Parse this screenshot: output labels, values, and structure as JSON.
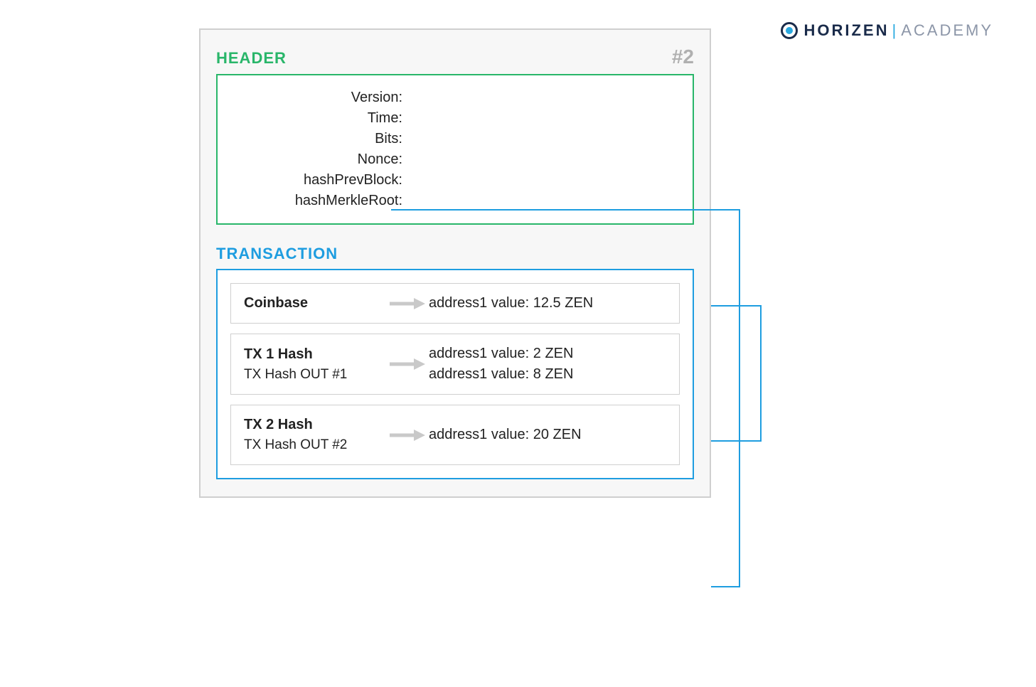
{
  "logo": {
    "brand": "HORIZEN",
    "sub": "ACADEMY"
  },
  "block": {
    "headerLabel": "HEADER",
    "blockNumber": "#2",
    "fields": [
      "Version:",
      "Time:",
      "Bits:",
      "Nonce:",
      "hashPrevBlock:",
      "hashMerkleRoot:"
    ],
    "transactionLabel": "TRANSACTION",
    "transactions": [
      {
        "title": "Coinbase",
        "sub": "",
        "outputs": [
          "address1 value: 12.5 ZEN"
        ]
      },
      {
        "title": "TX 1 Hash",
        "sub": "TX Hash OUT #1",
        "outputs": [
          "address1 value: 2 ZEN",
          "address1 value: 8 ZEN"
        ]
      },
      {
        "title": "TX 2 Hash",
        "sub": "TX Hash OUT #2",
        "outputs": [
          "address1 value: 20 ZEN"
        ]
      }
    ]
  },
  "colors": {
    "green": "#29b66a",
    "blue": "#1e9de0",
    "grey": "#cfcfcf"
  }
}
